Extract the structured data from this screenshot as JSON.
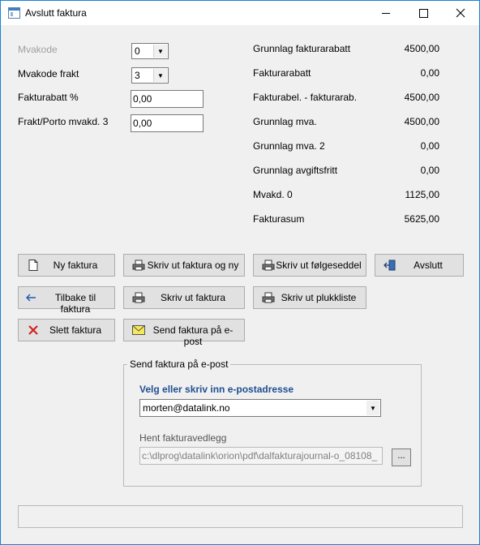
{
  "window": {
    "title": "Avslutt faktura",
    "icon": "app-window-icon"
  },
  "form": {
    "mvakode_label": "Mvakode",
    "mvakode_value": "0",
    "mvakode_frakt_label": "Mvakode frakt",
    "mvakode_frakt_value": "3",
    "fakturarabatt_label": "Fakturabatt %",
    "fakturarabatt_value": "0,00",
    "frakt_porto_label": "Frakt/Porto mvakd. 3",
    "frakt_porto_value": "0,00"
  },
  "summary": [
    {
      "label": "Grunnlag fakturarabatt",
      "value": "4500,00"
    },
    {
      "label": "Fakturarabatt",
      "value": "0,00"
    },
    {
      "label": "Fakturabel. - fakturarab.",
      "value": "4500,00"
    },
    {
      "label": "Grunnlag mva.",
      "value": "4500,00"
    },
    {
      "label": "Grunnlag mva. 2",
      "value": "0,00"
    },
    {
      "label": "Grunnlag avgiftsfritt",
      "value": "0,00"
    },
    {
      "label": "Mvakd. 0",
      "value": "1125,00"
    },
    {
      "label": "Fakturasum",
      "value": "5625,00"
    }
  ],
  "buttons": {
    "ny_faktura": "Ny faktura",
    "skriv_ut_faktura_og_ny": "Skriv ut faktura og ny",
    "skriv_ut_folgeseddel": "Skriv ut følgeseddel",
    "avslutt": "Avslutt",
    "tilbake_til_faktura": "Tilbake til faktura",
    "skriv_ut_faktura": "Skriv ut faktura",
    "skriv_ut_plukkliste": "Skriv ut plukkliste",
    "slett_faktura": "Slett faktura",
    "send_faktura_epost": "Send faktura på e-post"
  },
  "email_group": {
    "title": "Send faktura på e-post",
    "address_label": "Velg eller skriv inn e-postadresse",
    "address_value": "morten@datalink.no",
    "attachment_label": "Hent fakturavedlegg",
    "attachment_path": "c:\\dlprog\\datalink\\orion\\pdf\\dalfakturajournal-o_08108_",
    "browse_label": "..."
  },
  "colors": {
    "accent_title_blue": "#1f4f8f",
    "window_border": "#1883d7"
  }
}
